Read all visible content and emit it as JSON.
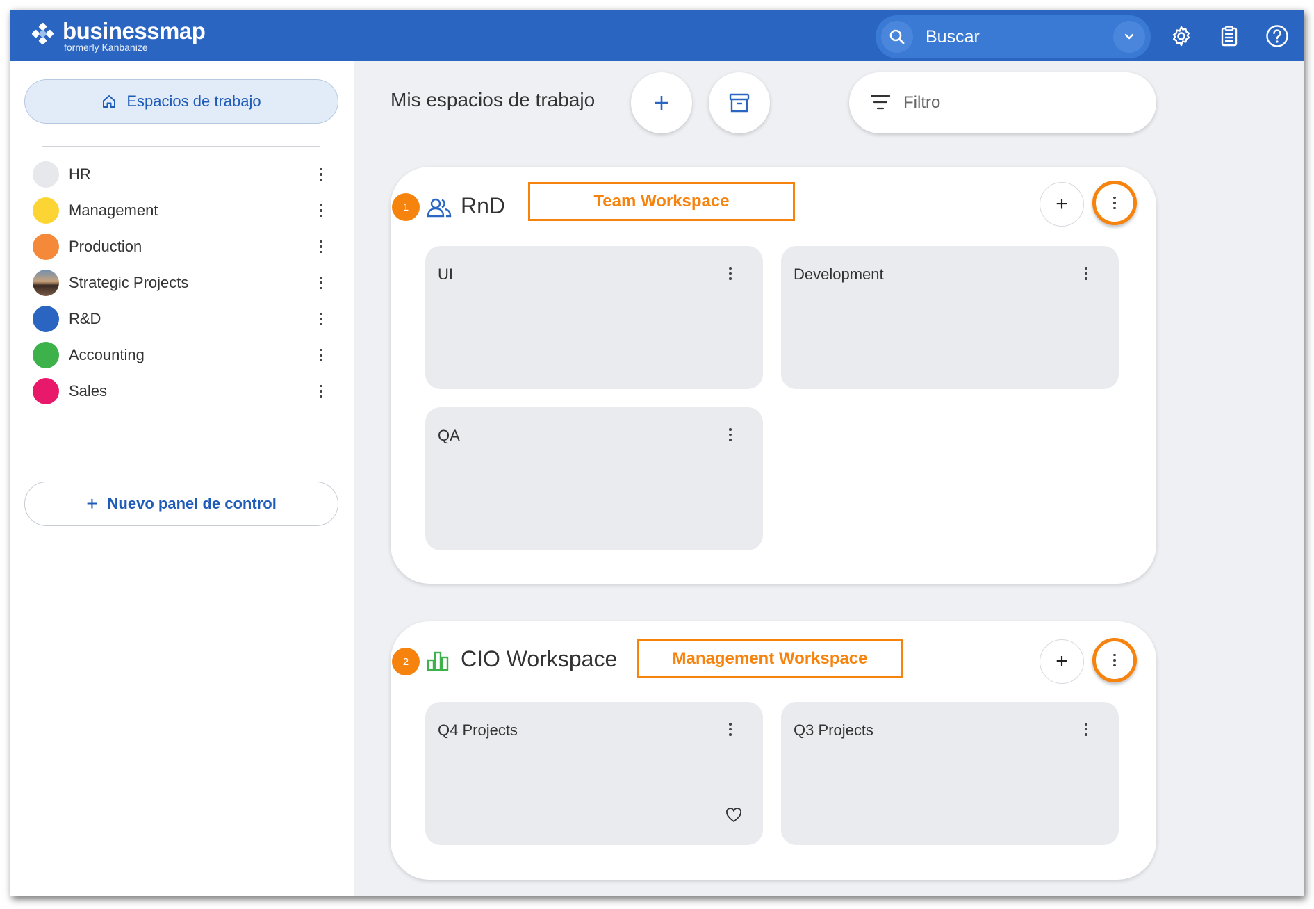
{
  "app": {
    "logo_name": "businessmap",
    "logo_sub": "formerly Kanbanize"
  },
  "search": {
    "placeholder": "Buscar"
  },
  "top_icons": [
    "gear-icon",
    "clipboard-icon",
    "help-icon"
  ],
  "sidebar": {
    "workspaces_button": "Espacios de trabajo",
    "items": [
      {
        "label": "HR",
        "color": "#e6e8eb"
      },
      {
        "label": "Management",
        "color": "#fcd535"
      },
      {
        "label": "Production",
        "color": "#f5893a"
      },
      {
        "label": "Strategic Projects",
        "color": "image"
      },
      {
        "label": "R&D",
        "color": "#2a65c1"
      },
      {
        "label": "Accounting",
        "color": "#3db14a"
      },
      {
        "label": "Sales",
        "color": "#e8196a"
      }
    ],
    "new_panel": "Nuevo panel de control"
  },
  "main": {
    "title": "Mis espacios de trabajo",
    "filter_placeholder": "Filtro"
  },
  "workspaces": [
    {
      "badge": "1",
      "name": "RnD",
      "icon": "team-icon",
      "annotation": "Team Workspace",
      "boards": [
        "UI",
        "Development",
        "QA"
      ]
    },
    {
      "badge": "2",
      "name": "CIO Workspace",
      "icon": "management-chart-icon",
      "annotation": "Management Workspace",
      "boards": [
        "Q4 Projects",
        "Q3 Projects"
      ]
    }
  ],
  "colors": {
    "brand_blue": "#2a65c1",
    "annotation_orange": "#f7830f"
  }
}
